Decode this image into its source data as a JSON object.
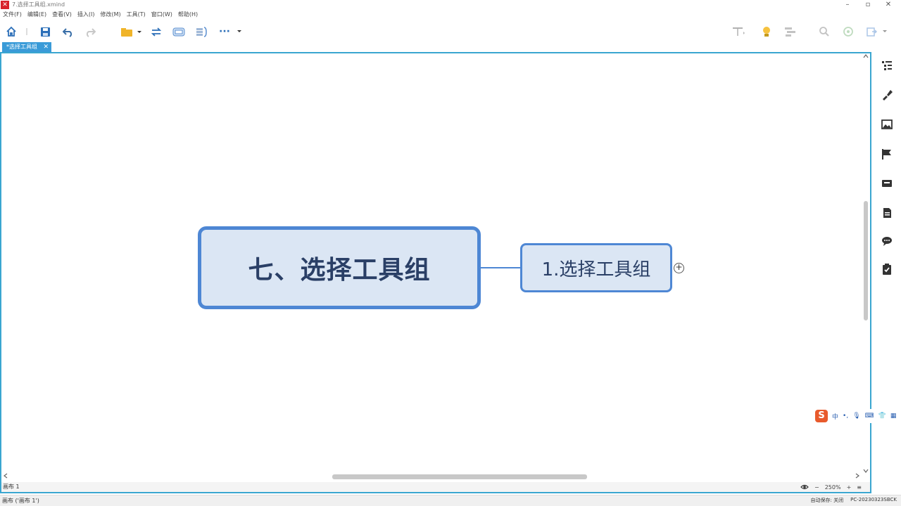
{
  "window": {
    "title": "7.选择工具组.xmind",
    "minimize": "–",
    "maximize": "▫",
    "close": "✕"
  },
  "menu": [
    "文件(F)",
    "编辑(E)",
    "查看(V)",
    "插入(I)",
    "修改(M)",
    "工具(T)",
    "窗口(W)",
    "帮助(H)"
  ],
  "toolbar": {
    "more": "···"
  },
  "tab": {
    "label": "*选择工具组",
    "close": "✕"
  },
  "mindmap": {
    "central_topic": "七、选择工具组",
    "sub_topic": "1.选择工具组",
    "expand": "+"
  },
  "sheetbar": {
    "sheet": "画布 1",
    "zoom_out": "−",
    "zoom": "250%",
    "zoom_in": "+",
    "menu": "≡"
  },
  "ime": {
    "logo": "S",
    "lang": "中",
    "punct": "•,",
    "mic": "🎙",
    "keyboard": "⌨",
    "skin": "👕",
    "tools": "▦"
  },
  "statusbar": {
    "left": "画布 ('画布 1')",
    "autosave_label": "自动保存: 关闭",
    "machine": "PC-20230323SBCK"
  },
  "colors": {
    "accent": "#3a9bd8",
    "node_border": "#4e87d4",
    "node_fill": "#dbe6f4",
    "node_text": "#2a3f66"
  }
}
